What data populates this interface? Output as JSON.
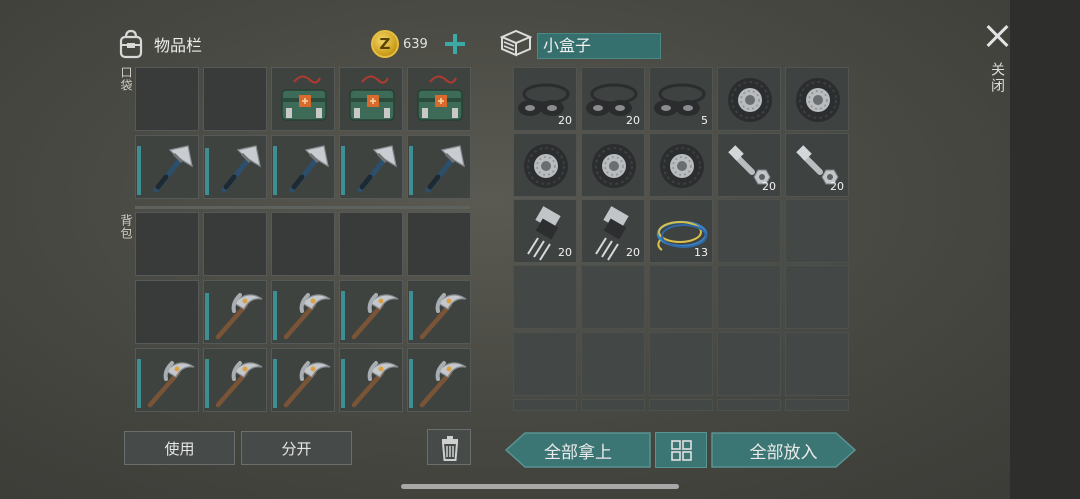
{
  "inventory": {
    "title": "物品栏",
    "coins": "639",
    "coin_symbol": "Z",
    "pocket_label": "口袋",
    "backpack_label": "背包",
    "pocket_slots": [
      {
        "item": null
      },
      {
        "item": null
      },
      {
        "item": "dynamite-bundle"
      },
      {
        "item": "dynamite-bundle"
      },
      {
        "item": "dynamite-bundle"
      },
      {
        "item": "hatchet",
        "durability": 0.95
      },
      {
        "item": "hatchet",
        "durability": 0.9
      },
      {
        "item": "hatchet",
        "durability": 0.95
      },
      {
        "item": "hatchet",
        "durability": 0.95
      },
      {
        "item": "hatchet",
        "durability": 0.95
      }
    ],
    "backpack_slots": [
      {
        "item": null
      },
      {
        "item": null
      },
      {
        "item": null
      },
      {
        "item": null
      },
      {
        "item": null
      },
      {
        "item": null
      },
      {
        "item": "pickaxe",
        "durability": 0.9
      },
      {
        "item": "pickaxe",
        "durability": 0.95
      },
      {
        "item": "pickaxe",
        "durability": 0.95
      },
      {
        "item": "pickaxe",
        "durability": 0.95
      },
      {
        "item": "pickaxe",
        "durability": 0.95
      },
      {
        "item": "pickaxe",
        "durability": 0.95
      },
      {
        "item": "pickaxe",
        "durability": 0.95
      },
      {
        "item": "pickaxe",
        "durability": 0.95
      },
      {
        "item": "pickaxe",
        "durability": 0.95
      }
    ]
  },
  "container": {
    "name": "小盒子",
    "slots": [
      {
        "item": "rubber-seals",
        "qty": "20"
      },
      {
        "item": "rubber-seals",
        "qty": "20"
      },
      {
        "item": "rubber-seals",
        "qty": "5"
      },
      {
        "item": "tire",
        "qty": ""
      },
      {
        "item": "tire",
        "qty": ""
      },
      {
        "item": "tire",
        "qty": ""
      },
      {
        "item": "tire",
        "qty": ""
      },
      {
        "item": "tire",
        "qty": ""
      },
      {
        "item": "bolts",
        "qty": "20"
      },
      {
        "item": "bolts",
        "qty": "20"
      },
      {
        "item": "transistor",
        "qty": "20"
      },
      {
        "item": "transistor",
        "qty": "20"
      },
      {
        "item": "wires",
        "qty": "13"
      },
      {
        "item": null,
        "qty": ""
      },
      {
        "item": null,
        "qty": ""
      }
    ],
    "empty_rows": 3
  },
  "close_label": "关闭",
  "buttons": {
    "use": "使用",
    "split": "分开",
    "take_all": "全部拿上",
    "put_all": "全部放入"
  },
  "colors": {
    "accent": "#3c7674",
    "durability": "#3e8f93",
    "coin": "#e6bf3e"
  }
}
